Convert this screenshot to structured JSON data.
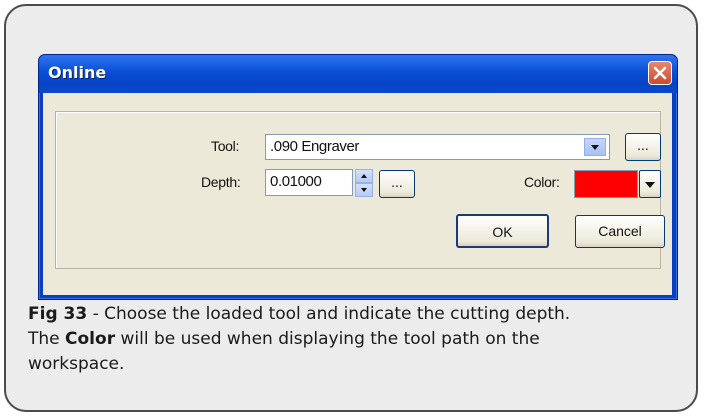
{
  "dialog": {
    "title": "Online",
    "tool_label": "Tool:",
    "tool_value": ".090 Engraver",
    "browse_label": "...",
    "depth_label": "Depth:",
    "depth_value": "0.01000",
    "color_label": "Color:",
    "color_swatch": "#ff0000",
    "ok_label": "OK",
    "cancel_label": "Cancel"
  },
  "caption": {
    "fig_label": "Fig 33",
    "line1_rest": " - Choose the loaded tool and indicate the cutting depth.",
    "line2_pre": "The ",
    "line2_bold": "Color",
    "line2_rest": " will be used when displaying the tool path on the",
    "line3": "workspace."
  },
  "icons": [
    "close-icon",
    "dropdown-arrow-icon",
    "spin-up-icon",
    "spin-down-icon"
  ]
}
